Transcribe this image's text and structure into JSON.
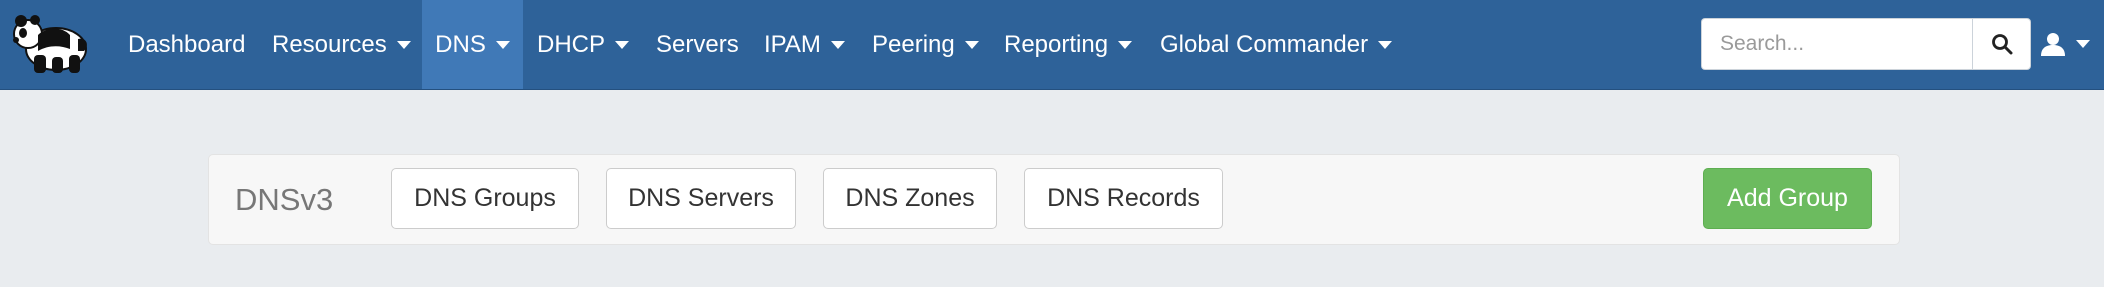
{
  "nav": {
    "items": [
      {
        "label": "Dashboard",
        "has_caret": false
      },
      {
        "label": "Resources",
        "has_caret": true
      },
      {
        "label": "DNS",
        "has_caret": true,
        "active": true
      },
      {
        "label": "DHCP",
        "has_caret": true
      },
      {
        "label": "Servers",
        "has_caret": false
      },
      {
        "label": "IPAM",
        "has_caret": true
      },
      {
        "label": "Peering",
        "has_caret": true
      },
      {
        "label": "Reporting",
        "has_caret": true
      },
      {
        "label": "Global Commander",
        "has_caret": true
      }
    ],
    "logo_icon": "panda-logo-icon",
    "user_icon": "user-icon"
  },
  "search": {
    "placeholder": "Search...",
    "value": "",
    "icon": "search-icon"
  },
  "dnsbar": {
    "title": "DNSv3",
    "buttons": [
      "DNS Groups",
      "DNS Servers",
      "DNS Zones",
      "DNS Records"
    ],
    "add_label": "Add Group"
  },
  "colors": {
    "navbar": "#2e6299",
    "nav_active": "#4079b7",
    "page_bg": "#e9ecef",
    "success": "#6cbb5f"
  }
}
